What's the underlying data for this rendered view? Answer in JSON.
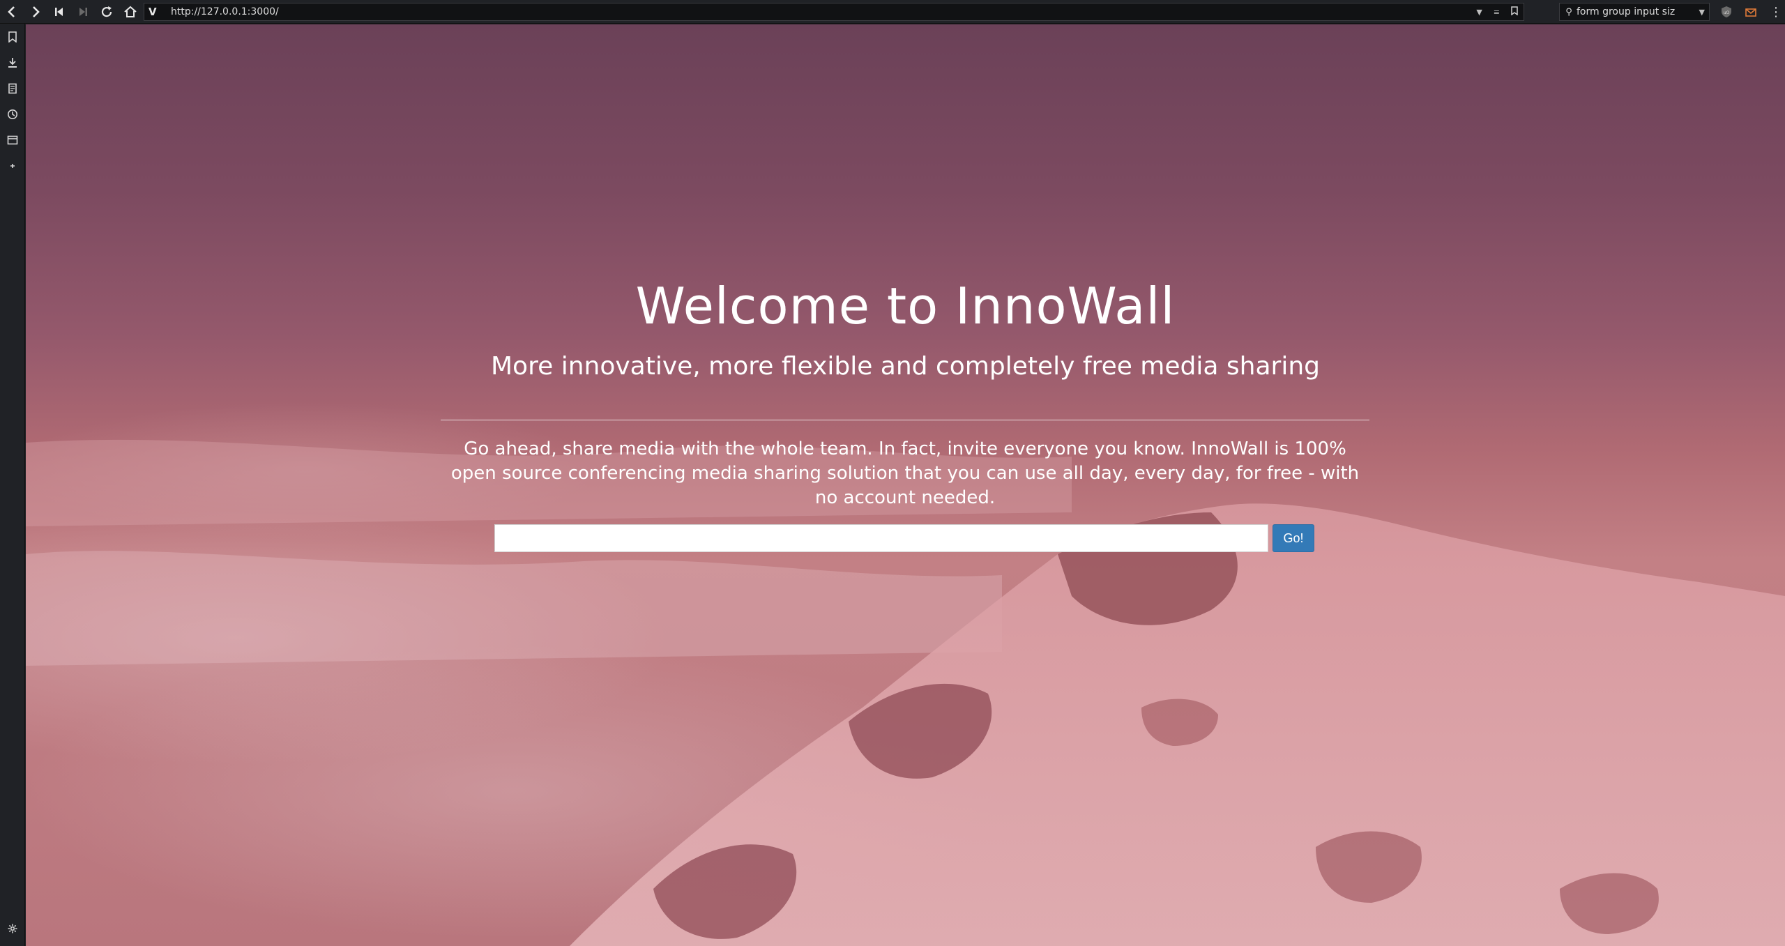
{
  "browser": {
    "url": "http://127.0.0.1:3000/",
    "url_logo": "V",
    "search_text": "form group input siz",
    "icons": {
      "back": "chevron-left-icon",
      "forward": "chevron-right-icon",
      "rewind": "skip-back-icon",
      "fast_forward": "skip-forward-icon",
      "reload": "reload-icon",
      "home": "home-icon",
      "dropdown": "chevron-down-icon",
      "reader": "reader-icon",
      "bookmark": "bookmark-icon",
      "search": "search-icon",
      "ublock": "ublock-icon",
      "mail": "mail-icon",
      "menu": "menu-dots-icon"
    }
  },
  "sidebar": {
    "icons": [
      "bookmarks-icon",
      "downloads-icon",
      "notes-icon",
      "history-icon",
      "window-icon",
      "add-panel-icon",
      "settings-icon"
    ]
  },
  "hero": {
    "title": "Welcome to InnoWall",
    "subtitle": "More innovative, more flexible and completely free media sharing",
    "description": "Go ahead, share media with the whole team. In fact, invite everyone you know. InnoWall is 100% open source conferencing media sharing solution that you can use all day, every day, for free - with no account needed.",
    "input_value": "",
    "go_label": "Go!"
  },
  "colors": {
    "button": "#337ab7",
    "chrome": "#202226",
    "overlay": "#b06a73"
  }
}
